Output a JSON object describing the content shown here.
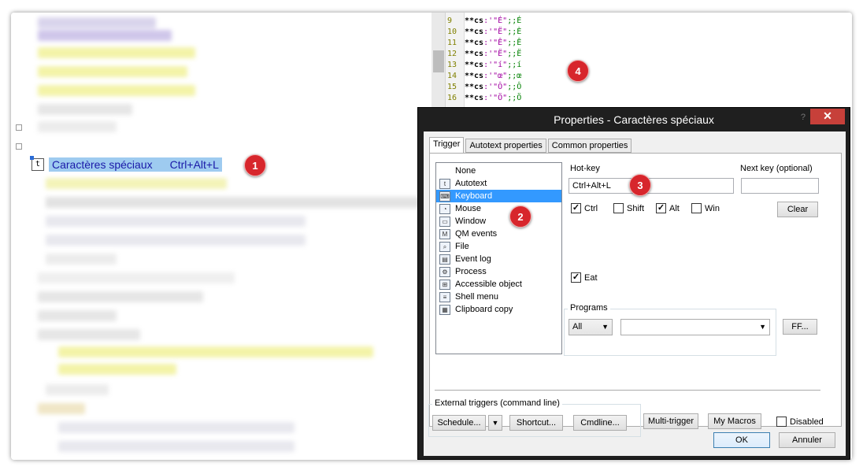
{
  "left_pane": {
    "macro_name": "Caractères spéciaux",
    "macro_hotkey": "Ctrl+Alt+L",
    "macro_icon_glyph": "t"
  },
  "editor": {
    "lines": [
      {
        "n": "9",
        "cmd": "**cs",
        "str": ":'\"É\"",
        "cmt": ";;É"
      },
      {
        "n": "10",
        "cmd": "**cs",
        "str": ":'\"Ë\"",
        "cmt": ";;È"
      },
      {
        "n": "11",
        "cmd": "**cs",
        "str": ":'\"Ê\"",
        "cmt": ";;Ê"
      },
      {
        "n": "12",
        "cmd": "**cs",
        "str": ":'\"Ë\"",
        "cmt": ";;Ë"
      },
      {
        "n": "13",
        "cmd": "**cs",
        "str": ":'\"í\"",
        "cmt": ";;í"
      },
      {
        "n": "14",
        "cmd": "**cs",
        "str": ":'\"œ\"",
        "cmt": ";;œ"
      },
      {
        "n": "15",
        "cmd": "**cs",
        "str": ":'\"Ô\"",
        "cmt": ";;Ô"
      },
      {
        "n": "16",
        "cmd": "**cs",
        "str": ":'\"Ö\"",
        "cmt": ";;Ö"
      }
    ]
  },
  "markers": [
    "1",
    "2",
    "3",
    "4"
  ],
  "dialog": {
    "title": "Properties - Caractères spéciaux",
    "help": "?",
    "close": "✕",
    "tabs": [
      "Trigger",
      "Autotext properties",
      "Common properties"
    ],
    "trigger_types": [
      {
        "label": "None",
        "icon": "",
        "icon_name": "none-icon",
        "selected": false
      },
      {
        "label": "Autotext",
        "icon": "t",
        "icon_name": "autotext-icon",
        "selected": false
      },
      {
        "label": "Keyboard",
        "icon": "⌨",
        "icon_name": "keyboard-icon",
        "selected": true
      },
      {
        "label": "Mouse",
        "icon": "◔",
        "icon_name": "mouse-icon",
        "selected": false
      },
      {
        "label": "Window",
        "icon": "▭",
        "icon_name": "window-icon",
        "selected": false
      },
      {
        "label": "QM events",
        "icon": "M",
        "icon_name": "qm-events-icon",
        "selected": false
      },
      {
        "label": "File",
        "icon": "⌕",
        "icon_name": "file-icon",
        "selected": false
      },
      {
        "label": "Event log",
        "icon": "▤",
        "icon_name": "event-log-icon",
        "selected": false
      },
      {
        "label": "Process",
        "icon": "⚙",
        "icon_name": "process-icon",
        "selected": false
      },
      {
        "label": "Accessible object",
        "icon": "⊞",
        "icon_name": "accessible-object-icon",
        "selected": false
      },
      {
        "label": "Shell menu",
        "icon": "≡",
        "icon_name": "shell-menu-icon",
        "selected": false
      },
      {
        "label": "Clipboard copy",
        "icon": "▦",
        "icon_name": "clipboard-copy-icon",
        "selected": false
      }
    ],
    "hotkey_label": "Hot-key",
    "hotkey_value": "Ctrl+Alt+L",
    "next_key_label": "Next key (optional)",
    "next_key_value": "",
    "modifiers": [
      {
        "label": "Ctrl",
        "checked": true
      },
      {
        "label": "Shift",
        "checked": false
      },
      {
        "label": "Alt",
        "checked": true
      },
      {
        "label": "Win",
        "checked": false
      }
    ],
    "clear_label": "Clear",
    "eat_label": "Eat",
    "eat_checked": true,
    "programs_label": "Programs",
    "programs_scope": "All",
    "programs_value": "",
    "ff_label": "FF...",
    "external_label": "External triggers (command line)",
    "schedule_label": "Schedule...",
    "dropdown_arrow": "▼",
    "shortcut_label": "Shortcut...",
    "cmdline_label": "Cmdline...",
    "multitrigger_label": "Multi-trigger",
    "mymacros_label": "My Macros",
    "disabled_label": "Disabled",
    "disabled_checked": false,
    "ok_label": "OK",
    "cancel_label": "Annuler"
  }
}
